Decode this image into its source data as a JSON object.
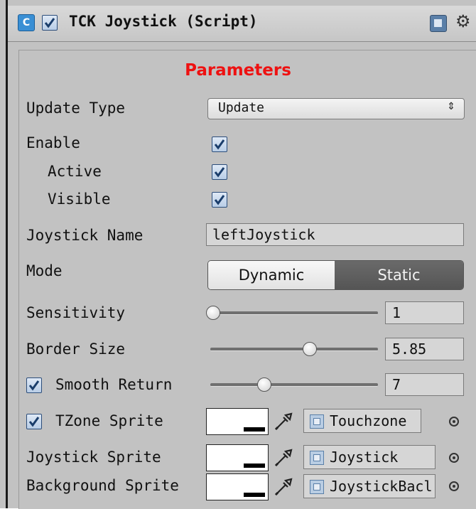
{
  "header": {
    "title": "TCK Joystick (Script)",
    "enabled": true,
    "script_icon": "script-icon",
    "help_icon": "help-icon",
    "settings_icon": "gear-icon"
  },
  "section": {
    "title": "Parameters",
    "color": "#ee1111"
  },
  "fields": {
    "update_type": {
      "label": "Update Type",
      "value": "Update"
    },
    "enable": {
      "label": "Enable",
      "checked": true
    },
    "active": {
      "label": "Active",
      "checked": true
    },
    "visible": {
      "label": "Visible",
      "checked": true
    },
    "joystick_name": {
      "label": "Joystick Name",
      "value": "leftJoystick"
    },
    "mode": {
      "label": "Mode",
      "options": [
        "Dynamic",
        "Static"
      ],
      "selected": "Static"
    },
    "sensitivity": {
      "label": "Sensitivity",
      "value": "1",
      "fraction": 0.0
    },
    "border_size": {
      "label": "Border Size",
      "value": "5.85",
      "fraction": 0.6
    },
    "smooth_return": {
      "label": "Smooth Return",
      "checked": true,
      "value": "7",
      "fraction": 0.34
    },
    "tzone_sprite": {
      "label": "TZone Sprite",
      "checked": true,
      "value": "Touchzone"
    },
    "joystick_sprite": {
      "label": "Joystick Sprite",
      "value": "Joystick"
    },
    "background_sprite": {
      "label": "Background Sprite",
      "value": "JoystickBacl"
    }
  }
}
